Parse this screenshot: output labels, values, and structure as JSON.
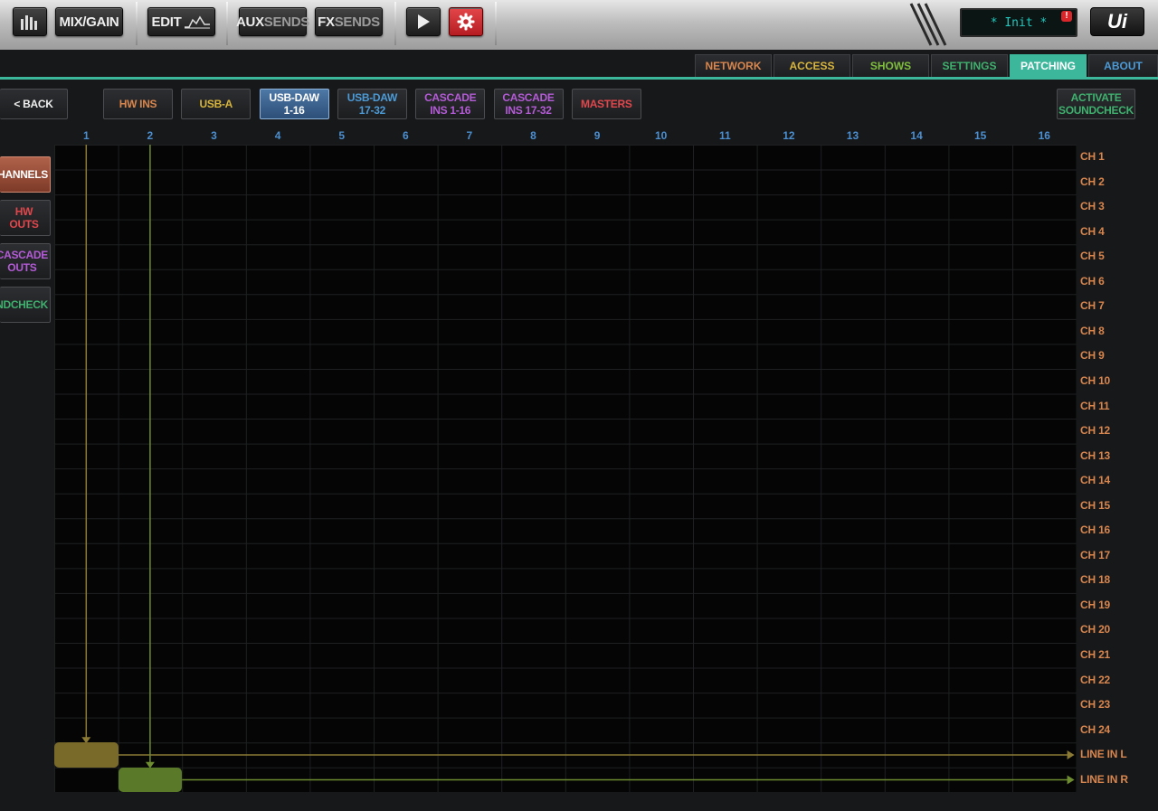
{
  "topbar": {
    "meters_icon": "meters-icon",
    "mix_gain_label": "MIX/GAIN",
    "edit_label": "EDIT",
    "edit_icon": "eq-curve-icon",
    "aux_sends": {
      "main": "AUX",
      "sub": "SENDS"
    },
    "fx_sends": {
      "main": "FX",
      "sub": "SENDS"
    },
    "play_icon": "play-icon",
    "settings_icon": "gear-icon",
    "lcd_text": "* Init *",
    "lcd_badge": "!",
    "logo": "Ui"
  },
  "tabs": [
    {
      "label": "NETWORK",
      "color": "#d8864e",
      "active": false
    },
    {
      "label": "ACCESS",
      "color": "#d7b43c",
      "active": false
    },
    {
      "label": "SHOWS",
      "color": "#7fbd3c",
      "active": false
    },
    {
      "label": "SETTINGS",
      "color": "#3fb06e",
      "active": false
    },
    {
      "label": "PATCHING",
      "color": "#ffffff",
      "active": true
    },
    {
      "label": "ABOUT",
      "color": "#4c9ad6",
      "active": false
    }
  ],
  "back_label": "< BACK",
  "sources": [
    {
      "line1": "HW INS",
      "line2": "",
      "color": "#d8864e",
      "active": false
    },
    {
      "line1": "USB-A",
      "line2": "",
      "color": "#d7b43c",
      "active": false
    },
    {
      "line1": "USB-DAW",
      "line2": "1-16",
      "color": "#ffffff",
      "active": true
    },
    {
      "line1": "USB-DAW",
      "line2": "17-32",
      "color": "#4c9ad6",
      "active": false
    },
    {
      "line1": "CASCADE",
      "line2": "INS 1-16",
      "color": "#b45bd6",
      "active": false
    },
    {
      "line1": "CASCADE",
      "line2": "INS 17-32",
      "color": "#b45bd6",
      "active": false
    },
    {
      "line1": "MASTERS",
      "line2": "",
      "color": "#e0474c",
      "active": false
    }
  ],
  "activate_soundcheck": {
    "line1": "ACTIVATE",
    "line2": "SOUNDCHECK",
    "color": "#3fb06e"
  },
  "destinations": [
    {
      "line1": "HANNELS",
      "line2": "",
      "color": "#ffffff",
      "active": true
    },
    {
      "line1": "HW OUTS",
      "line2": "",
      "color": "#e0474c",
      "active": false
    },
    {
      "line1": "CASCADE",
      "line2": "OUTS",
      "color": "#b45bd6",
      "active": false
    },
    {
      "line1": "OUNDCHECK",
      "line2": "",
      "color": "#3fb06e",
      "active": false
    }
  ],
  "columns": [
    "1",
    "2",
    "3",
    "4",
    "5",
    "6",
    "7",
    "8",
    "9",
    "10",
    "11",
    "12",
    "13",
    "14",
    "15",
    "16"
  ],
  "rows": [
    "CH 1",
    "CH 2",
    "CH 3",
    "CH 4",
    "CH 5",
    "CH 6",
    "CH 7",
    "CH 8",
    "CH 9",
    "CH 10",
    "CH 11",
    "CH 12",
    "CH 13",
    "CH 14",
    "CH 15",
    "CH 16",
    "CH 17",
    "CH 18",
    "CH 19",
    "CH 20",
    "CH 21",
    "CH 22",
    "CH 23",
    "CH 24",
    "LINE IN L",
    "LINE IN R"
  ],
  "patches": [
    {
      "column": 1,
      "row": 25,
      "color": "#7a6a2a",
      "line_color": "#8a7a34"
    },
    {
      "column": 2,
      "row": 26,
      "color": "#5a7a2a",
      "line_color": "#6e8c30"
    }
  ]
}
